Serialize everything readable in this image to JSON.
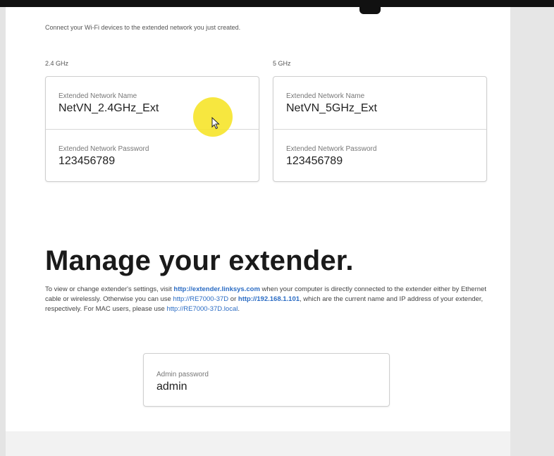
{
  "wifi": {
    "intro_text": "Connect your Wi-Fi devices to the extended network you just created.",
    "band_24": {
      "label": "2.4 GHz",
      "network_name_label": "Extended Network Name",
      "network_name": "NetVN_2.4GHz_Ext",
      "password_label": "Extended Network Password",
      "password": "123456789"
    },
    "band_5": {
      "label": "5 GHz",
      "network_name_label": "Extended Network Name",
      "network_name": "NetVN_5GHz_Ext",
      "password_label": "Extended Network Password",
      "password": "123456789"
    }
  },
  "manage": {
    "title": "Manage your extender.",
    "desc_part1": "To view or change extender's settings, visit ",
    "link1": "http://extender.linksys.com",
    "desc_part2": " when your computer is directly connected to the extender either by Ethernet cable or wirelessly. Otherwise you can use ",
    "link2": "http://RE7000-37D",
    "desc_part3": " or ",
    "link3": "http://192.168.1.101",
    "desc_part4": ", which are the current name and IP address of your extender, respectively. For MAC users, please use ",
    "link4": "http://RE7000-37D.local",
    "desc_part5": ".",
    "admin_label": "Admin password",
    "admin_value": "admin"
  },
  "colors": {
    "link": "#2b6cc4",
    "cursor_highlight": "#f6e42a",
    "heading": "#1a1a1a"
  }
}
